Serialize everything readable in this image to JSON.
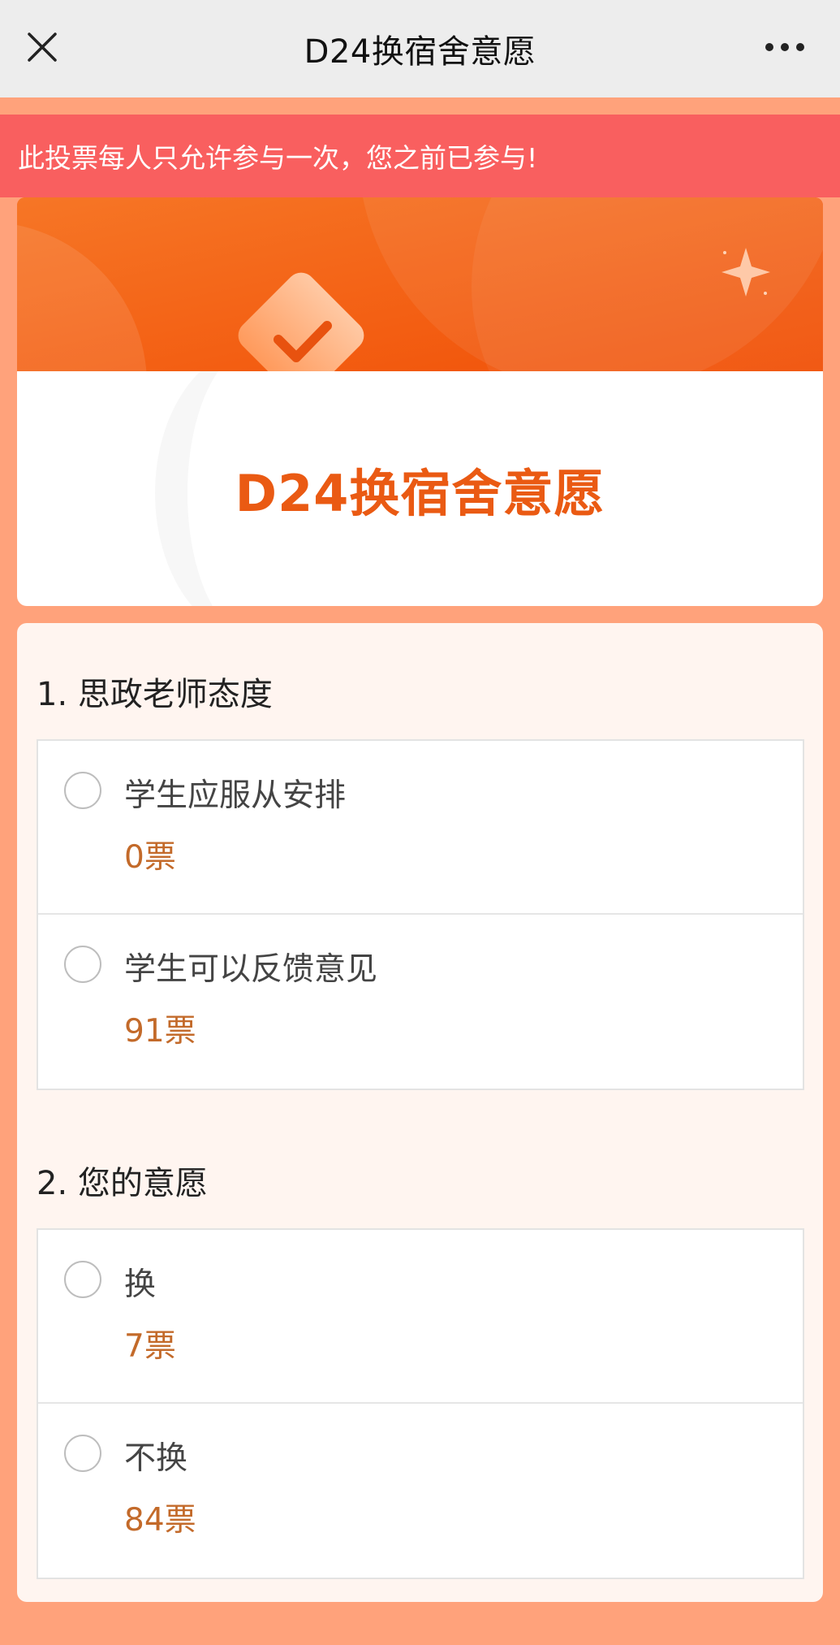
{
  "header": {
    "title": "D24换宿舍意愿",
    "close_icon": "close-icon",
    "more_icon": "more-icon"
  },
  "alert": {
    "text": "此投票每人只允许参与一次，您之前已参与!"
  },
  "banner": {
    "icon": "checkmark-badge-icon",
    "sparkle": "sparkle-icon",
    "color": "#f45a0c"
  },
  "poll": {
    "title": "D24换宿舍意愿"
  },
  "questions": [
    {
      "label": "1. 思政老师态度",
      "options": [
        {
          "label": "学生应服从安排",
          "votes": "0票"
        },
        {
          "label": "学生可以反馈意见",
          "votes": "91票"
        }
      ]
    },
    {
      "label": "2. 您的意愿",
      "options": [
        {
          "label": "换",
          "votes": "7票"
        },
        {
          "label": "不换",
          "votes": "84票"
        }
      ]
    }
  ],
  "colors": {
    "page_bg": "#ffa27b",
    "alert_bg": "#f95f5f",
    "title_accent": "#ea5a13",
    "votes_text": "#c36a2a"
  }
}
